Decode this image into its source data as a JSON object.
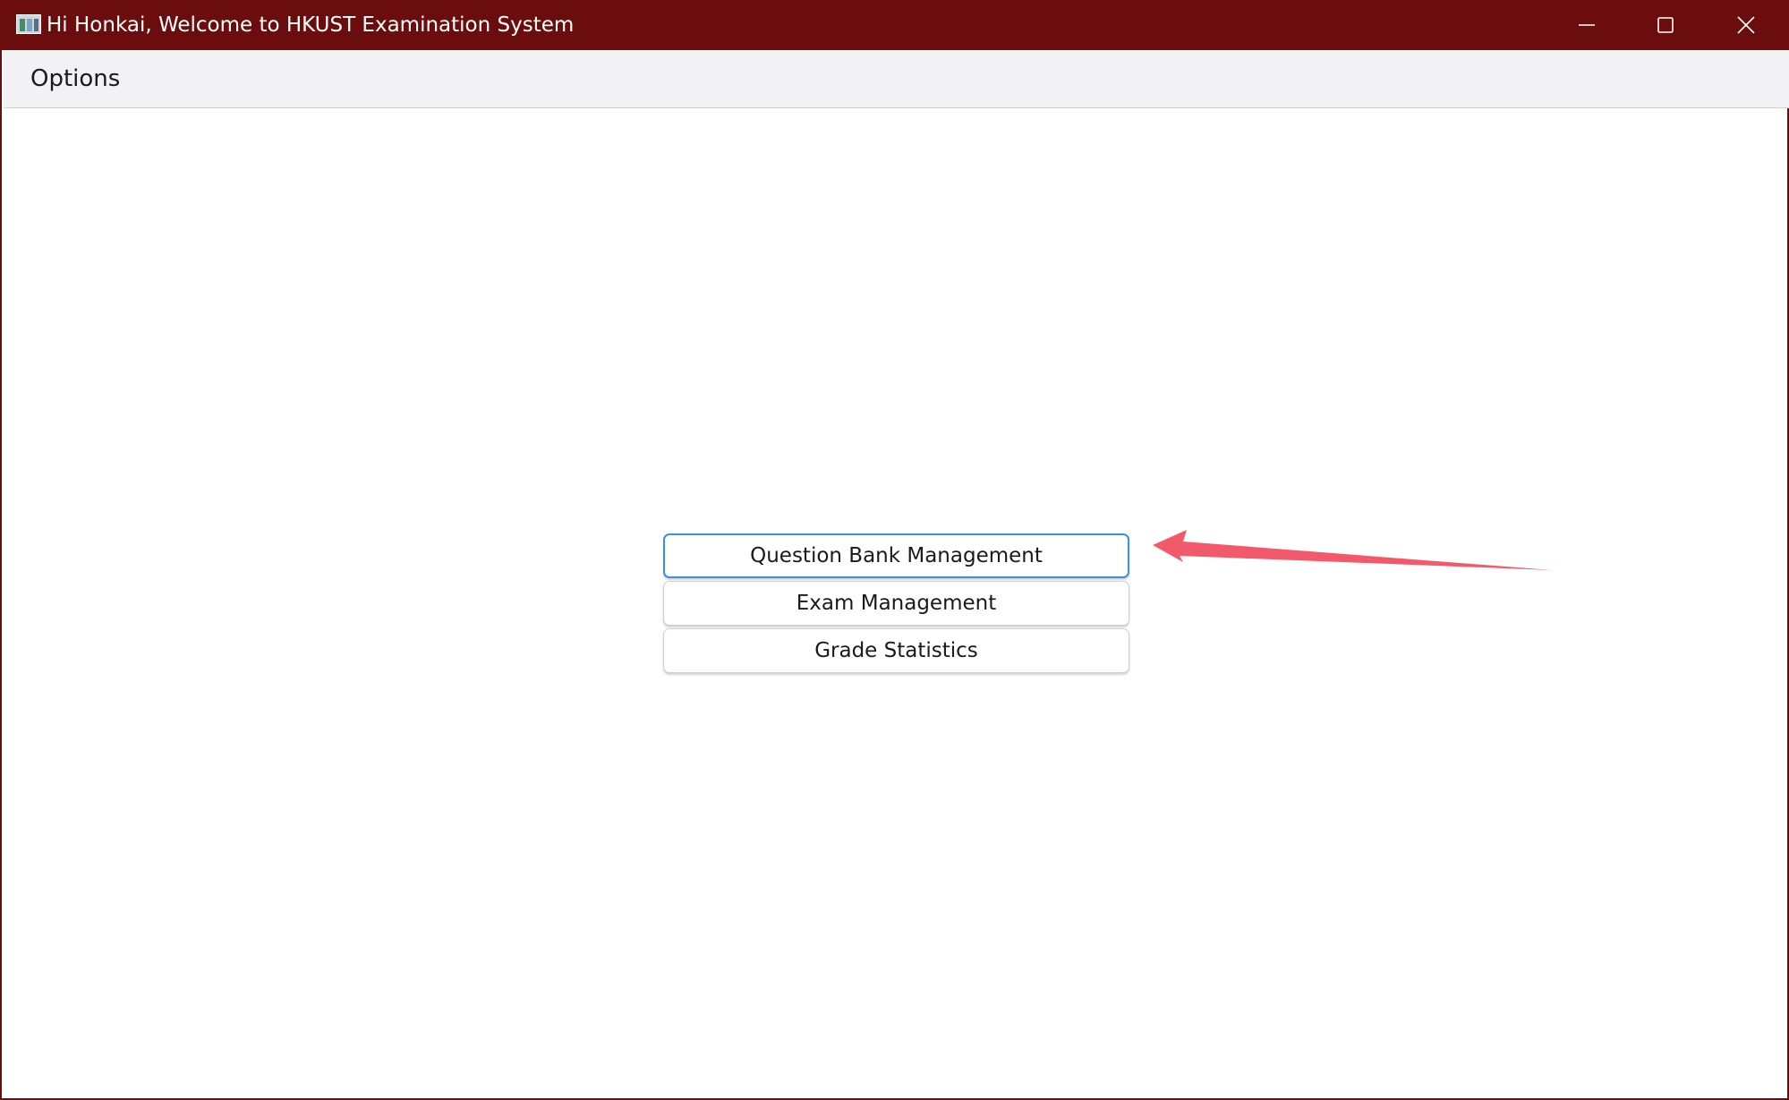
{
  "window": {
    "title": "Hi Honkai, Welcome to HKUST Examination System",
    "titlebar_color": "#6b0d0d",
    "app_icon": "app-chart-icon"
  },
  "window_controls": {
    "minimize_icon": "minimize-icon",
    "maximize_icon": "maximize-icon",
    "close_icon": "close-icon"
  },
  "menubar": {
    "items": [
      {
        "label": "Options"
      }
    ]
  },
  "main": {
    "buttons": [
      {
        "label": "Question Bank Management",
        "focused": true
      },
      {
        "label": "Exam Management",
        "focused": false
      },
      {
        "label": "Grade Statistics",
        "focused": false
      }
    ]
  },
  "annotation": {
    "type": "arrow",
    "color": "#f2596a",
    "points_to": "Question Bank Management"
  },
  "colors": {
    "focus_border": "#3d8fe0",
    "menubar_bg": "#f2f2f5"
  }
}
